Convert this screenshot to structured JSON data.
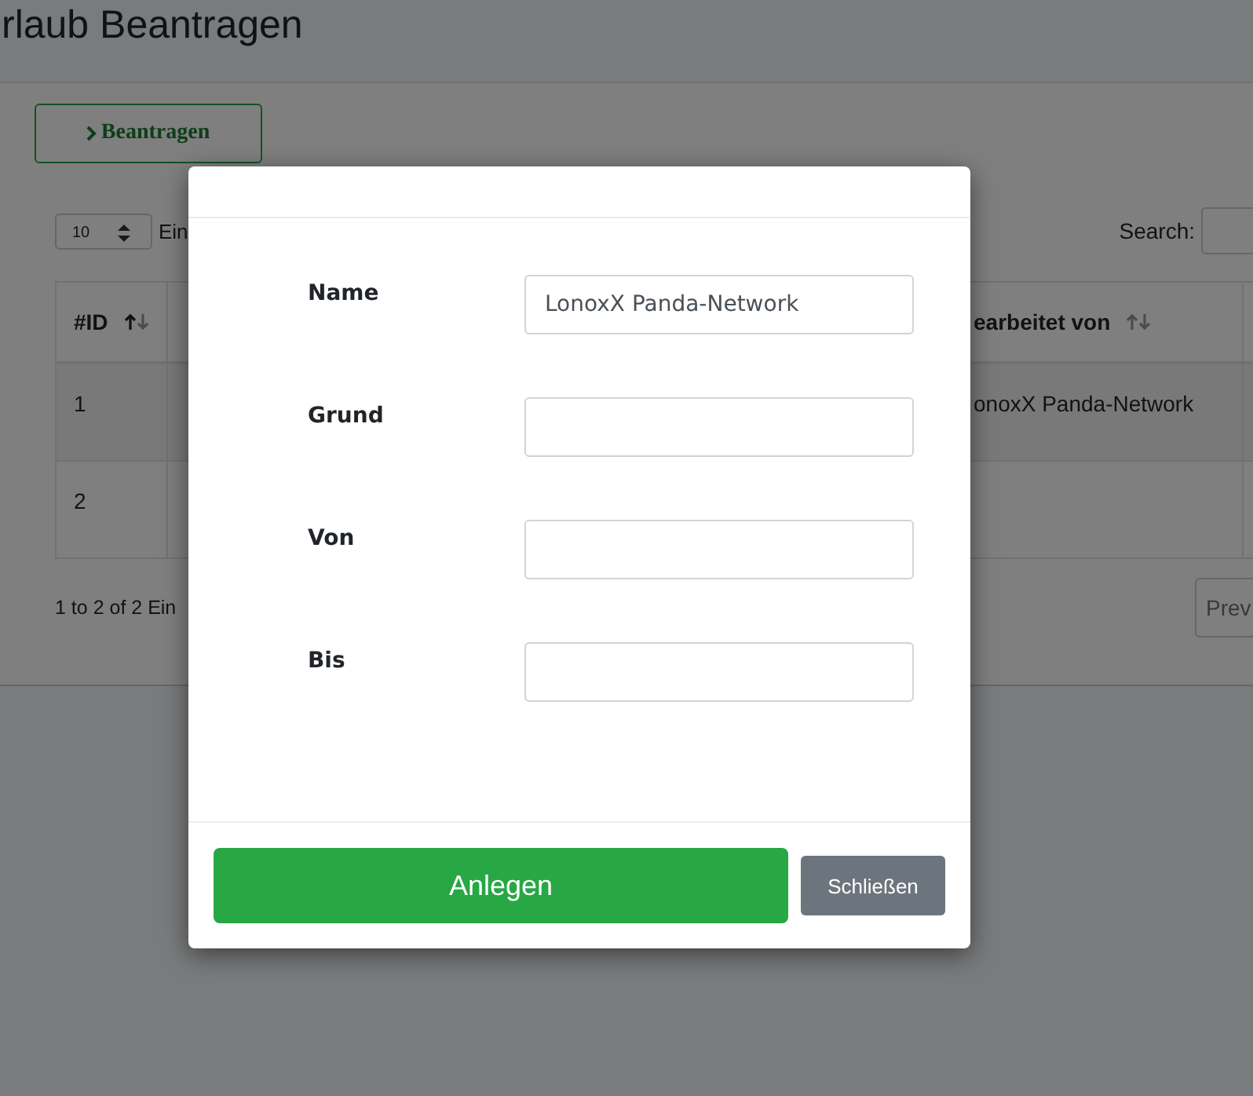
{
  "page": {
    "title": "rlaub Beantragen",
    "action_button": "Beantragen"
  },
  "table_controls": {
    "page_length": "10",
    "length_label": "Ein",
    "search_label": "Search:"
  },
  "table": {
    "columns": [
      "#ID",
      "earbeitet von"
    ],
    "rows": [
      {
        "id": "1",
        "edited_by": "onoxX Panda-Network"
      },
      {
        "id": "2"
      }
    ]
  },
  "table_info": "1 to 2 of 2 Ein",
  "pager": {
    "previous": "Prev"
  },
  "modal": {
    "fields": [
      {
        "label": "Name",
        "value": "LonoxX Panda-Network"
      },
      {
        "label": "Grund"
      },
      {
        "label": "Von"
      },
      {
        "label": "Bis"
      }
    ],
    "submit": "Anlegen",
    "close": "Schließen"
  }
}
